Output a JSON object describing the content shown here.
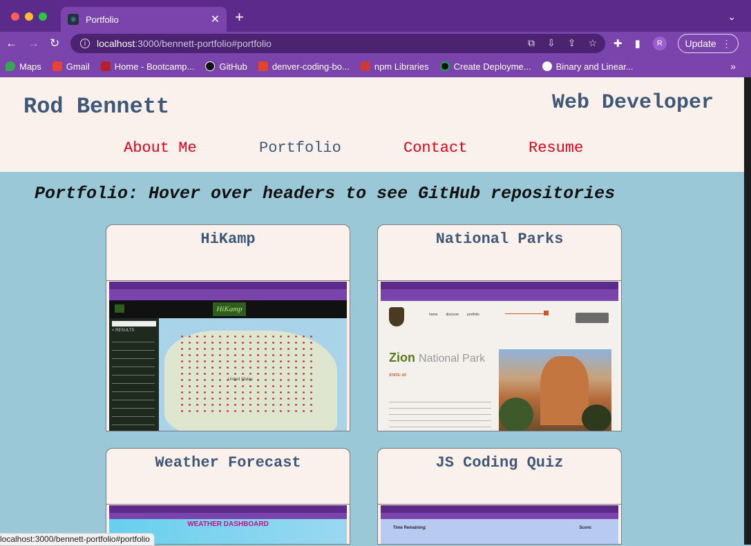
{
  "browser": {
    "tab_title": "Portfolio",
    "url_host": "localhost",
    "url_path": ":3000/bennett-portfolio#portfolio",
    "avatar_letter": "R",
    "update_label": "Update",
    "bookmarks": [
      {
        "label": "Maps",
        "color": "#34a853"
      },
      {
        "label": "Gmail",
        "color": "#ea4335"
      },
      {
        "label": "Home - Bootcamp...",
        "color": "#b5202b"
      },
      {
        "label": "GitHub",
        "color": "#111111"
      },
      {
        "label": "denver-coding-bo...",
        "color": "#e24329"
      },
      {
        "label": "npm Libraries",
        "color": "#cb3837"
      },
      {
        "label": "Create Deployme...",
        "color": "#13aa52"
      },
      {
        "label": "Binary and Linear...",
        "color": "#ffffff"
      }
    ],
    "status_url": "localhost:3000/bennett-portfolio#portfolio"
  },
  "site": {
    "name": "Rod Bennett",
    "role": "Web Developer",
    "nav": [
      "About Me",
      "Portfolio",
      "Contact",
      "Resume"
    ],
    "active_nav": "Portfolio",
    "section_title": "Portfolio: Hover over headers to see GitHub repositories"
  },
  "projects": [
    {
      "title": "HiKamp"
    },
    {
      "title": "National Parks"
    },
    {
      "title": "Weather Forecast"
    },
    {
      "title": "JS Coding Quiz"
    }
  ],
  "screenshots": {
    "hikamp_logo": "HiKamp",
    "hikamp_results": "< RESULTS",
    "map_label": "United States",
    "parks_nav": [
      "home",
      "discover",
      "portfolio"
    ],
    "parks_park_name": "Zion",
    "parks_park_suffix": "National Park",
    "parks_state": "STATE: UT",
    "weather_heading": "WEATHER DASHBOARD",
    "quiz_time": "Time Remaining:",
    "quiz_score": "Score:"
  },
  "colors": {
    "header_bg": "#faf1ec",
    "page_bg": "#9ac8d6",
    "accent_red": "#e4001b",
    "title_blue": "#3f5878",
    "chrome_purple": "#5b2a8a"
  }
}
